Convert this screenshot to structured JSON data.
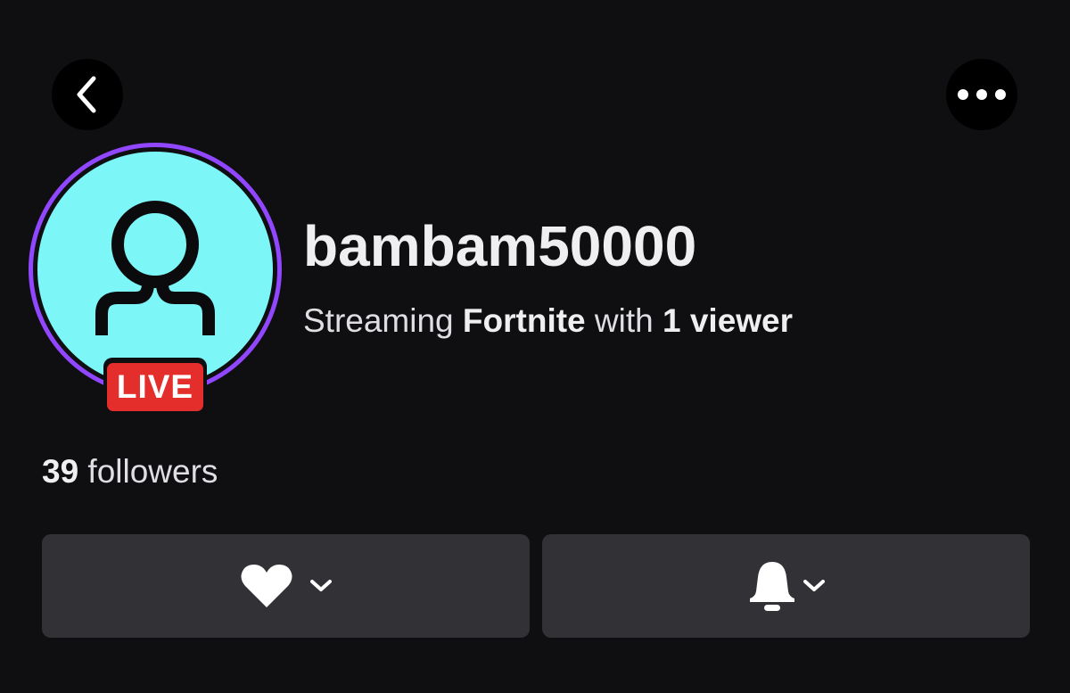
{
  "header": {
    "back_icon": "chevron-left-icon",
    "more_icon": "more-horizontal-icon"
  },
  "profile": {
    "username": "bambam50000",
    "live_badge": "LIVE",
    "status": {
      "prefix": "Streaming ",
      "game": "Fortnite",
      "middle": " with ",
      "viewers": "1 viewer"
    },
    "followers": {
      "count": "39",
      "label": " followers"
    },
    "avatar_icon": "user-icon"
  },
  "actions": {
    "follow_icon": "heart-icon",
    "notify_icon": "bell-icon",
    "dropdown_icon": "chevron-down-icon"
  },
  "colors": {
    "background": "#0f0f12",
    "avatar_bg": "#7cf6f6",
    "live_ring": "#9147ff",
    "live_badge": "#e42e2c",
    "button_bg": "#323236"
  }
}
